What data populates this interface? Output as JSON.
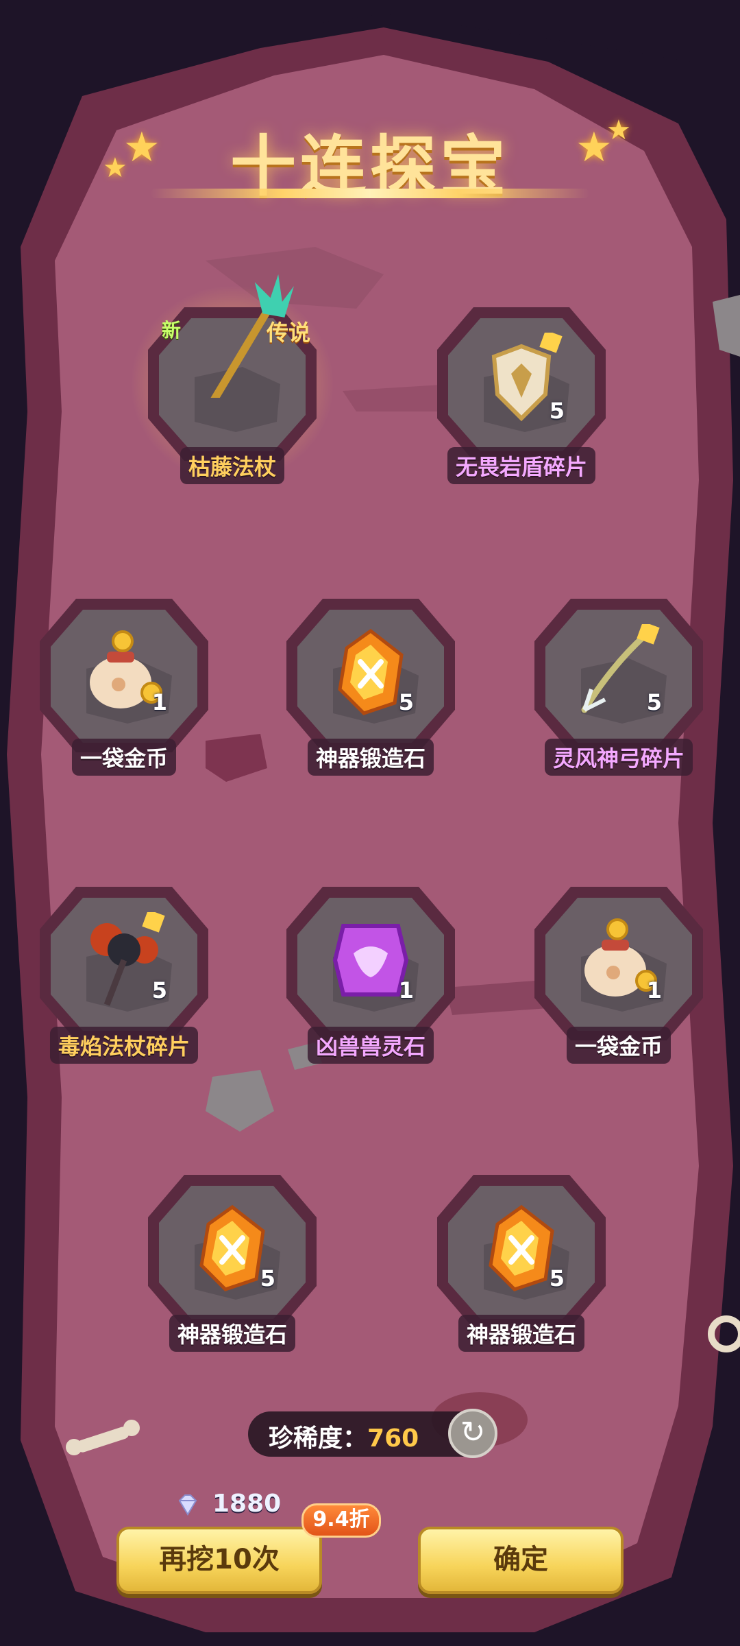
{
  "title": "十连探宝",
  "items": [
    {
      "name": "枯藤法杖",
      "count": "",
      "new_tag": "新",
      "rarity_tag": "传说",
      "label_color": "orange",
      "icon": "staff-icon"
    },
    {
      "name": "无畏岩盾碎片",
      "count": "5",
      "label_color": "purple",
      "icon": "shield-fragment-icon"
    },
    {
      "name": "一袋金币",
      "count": "1",
      "label_color": "white",
      "icon": "gold-bag-icon"
    },
    {
      "name": "神器锻造石",
      "count": "5",
      "label_color": "white",
      "icon": "forge-stone-icon"
    },
    {
      "name": "灵风神弓碎片",
      "count": "5",
      "label_color": "purple",
      "icon": "bow-fragment-icon"
    },
    {
      "name": "毒焰法杖碎片",
      "count": "5",
      "label_color": "orange",
      "icon": "poison-staff-fragment-icon"
    },
    {
      "name": "凶兽兽灵石",
      "count": "1",
      "label_color": "purple",
      "icon": "beast-spirit-stone-icon"
    },
    {
      "name": "一袋金币",
      "count": "1",
      "label_color": "white",
      "icon": "gold-bag-icon"
    },
    {
      "name": "神器锻造石",
      "count": "5",
      "label_color": "white",
      "icon": "forge-stone-icon"
    },
    {
      "name": "神器锻造石",
      "count": "5",
      "label_color": "white",
      "icon": "forge-stone-icon"
    }
  ],
  "rarity": {
    "label": "珍稀度：",
    "value": "760"
  },
  "currency": {
    "amount": "1880",
    "icon": "diamond-icon"
  },
  "buttons": {
    "dig_again": "再挖10次",
    "confirm": "确定",
    "discount": "9.4折"
  },
  "colors": {
    "cave": "#a45a76",
    "cave_edge": "#6e2e48",
    "background": "#1e1428",
    "button": "#f7d45a",
    "gold_text": "#ffc94a"
  }
}
